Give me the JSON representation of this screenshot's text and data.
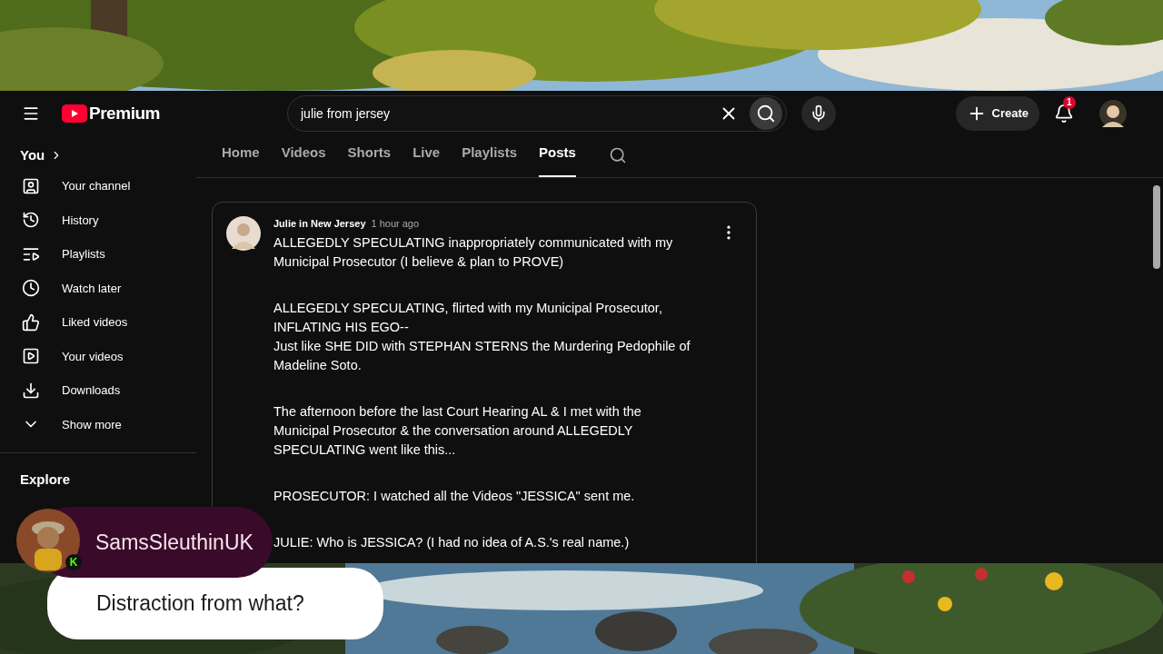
{
  "header": {
    "logo_text": "Premium",
    "search": {
      "value": "julie from jersey"
    },
    "create_label": "Create",
    "notification_count": "1"
  },
  "sidebar": {
    "section_title": "You",
    "items": [
      {
        "label": "Your channel"
      },
      {
        "label": "History"
      },
      {
        "label": "Playlists"
      },
      {
        "label": "Watch later"
      },
      {
        "label": "Liked videos"
      },
      {
        "label": "Your videos"
      },
      {
        "label": "Downloads"
      },
      {
        "label": "Show more"
      }
    ],
    "explore_title": "Explore"
  },
  "tabs": [
    {
      "label": "Home",
      "selected": false
    },
    {
      "label": "Videos",
      "selected": false
    },
    {
      "label": "Shorts",
      "selected": false
    },
    {
      "label": "Live",
      "selected": false
    },
    {
      "label": "Playlists",
      "selected": false
    },
    {
      "label": "Posts",
      "selected": true
    }
  ],
  "post": {
    "author": "Julie in New Jersey",
    "time": "1 hour ago",
    "paragraphs": [
      "ALLEGEDLY SPECULATING inappropriately communicated with my Municipal Prosecutor (I believe & plan to PROVE)",
      "ALLEGEDLY SPECULATING, flirted with my Municipal Prosecutor, INFLATING HIS EGO--\nJust like SHE DID with STEPHAN STERNS the Murdering Pedophile of Madeline Soto.",
      "The afternoon before the last Court Hearing AL & I met with the Municipal Prosecutor & the conversation around ALLEGEDLY SPECULATING went like this...",
      "PROSECUTOR: I watched all the Videos \"JESSICA\" sent me.",
      "JULIE: Who is JESSICA? (I had no idea of A.S.'s real name.)"
    ]
  },
  "chat": {
    "username": "SamsSleuthinUK",
    "badge": "K",
    "message": "Distraction from what?"
  }
}
